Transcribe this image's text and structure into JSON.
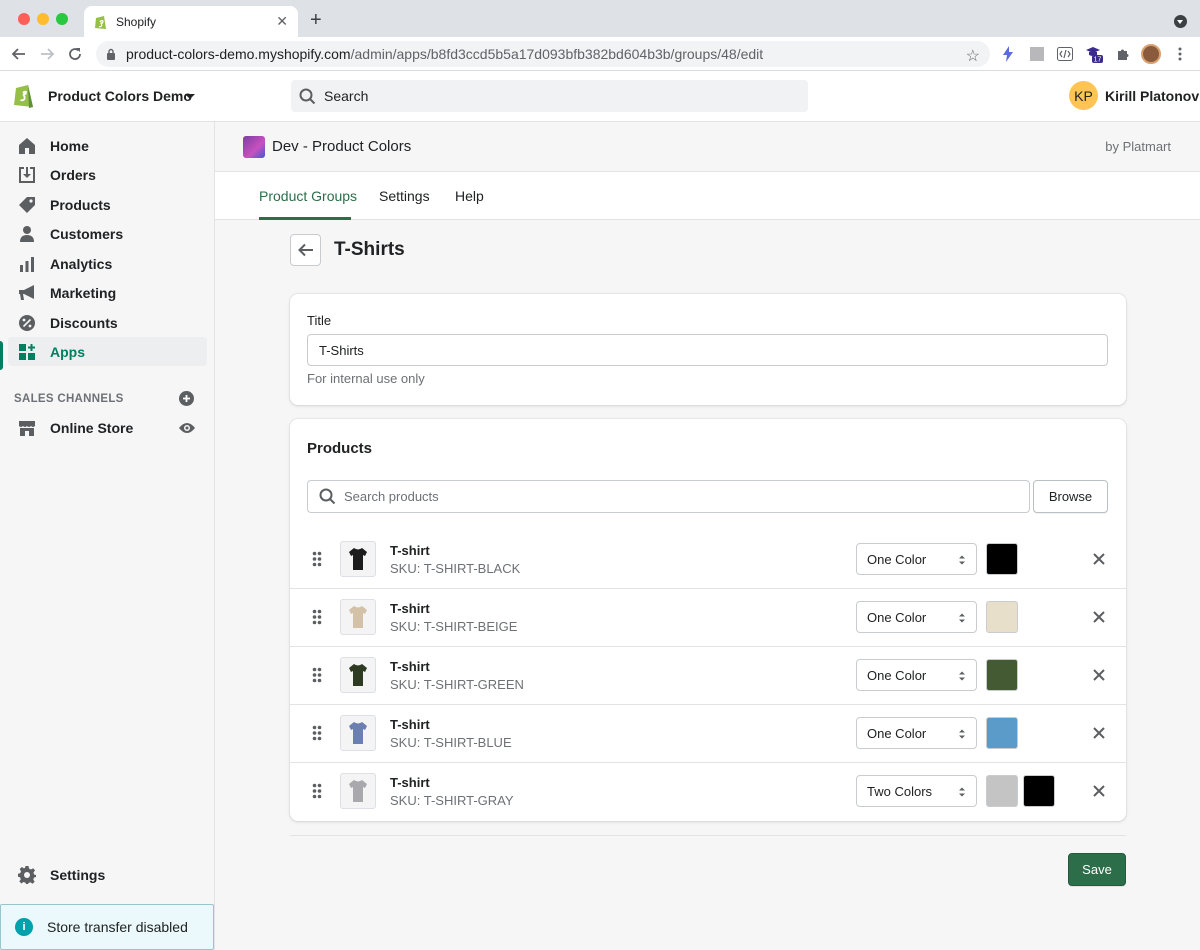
{
  "browser": {
    "tab_title": "Shopify",
    "url_host": "product-colors-demo.myshopify.com",
    "url_path": "/admin/apps/b8fd3ccd5b5a17d093bfb382bd604b3b/groups/48/edit",
    "ext_badge": "17"
  },
  "topbar": {
    "store_name": "Product Colors Demo",
    "search_placeholder": "Search",
    "avatar_initials": "KP",
    "user_name": "Kirill Platonov"
  },
  "sidebar": {
    "items": [
      {
        "label": "Home",
        "icon": "home-icon"
      },
      {
        "label": "Orders",
        "icon": "orders-icon"
      },
      {
        "label": "Products",
        "icon": "tag-icon"
      },
      {
        "label": "Customers",
        "icon": "person-icon"
      },
      {
        "label": "Analytics",
        "icon": "bar-chart-icon"
      },
      {
        "label": "Marketing",
        "icon": "megaphone-icon"
      },
      {
        "label": "Discounts",
        "icon": "discount-icon"
      },
      {
        "label": "Apps",
        "icon": "apps-icon",
        "active": true
      }
    ],
    "sales_channels_label": "SALES CHANNELS",
    "online_store_label": "Online Store",
    "settings_label": "Settings",
    "transfer_text": "Store transfer disabled",
    "accent_color": "#008060"
  },
  "app": {
    "title": "Dev - Product Colors",
    "by": "by Platmart",
    "tabs": [
      "Product Groups",
      "Settings",
      "Help"
    ],
    "selected_tab": "Product Groups"
  },
  "page": {
    "title": "T-Shirts",
    "title_label": "Title",
    "title_value": "T-Shirts",
    "title_help": "For internal use only",
    "products_heading": "Products",
    "search_products_placeholder": "Search products",
    "browse_label": "Browse",
    "save_label": "Save"
  },
  "products": [
    {
      "name": "T-shirt",
      "sku": "SKU: T-SHIRT-BLACK",
      "mode": "One Color",
      "shirt_color": "#1c1c1c",
      "colors": [
        "#000000"
      ]
    },
    {
      "name": "T-shirt",
      "sku": "SKU: T-SHIRT-BEIGE",
      "mode": "One Color",
      "shirt_color": "#d3c2a8",
      "colors": [
        "#e8dfcb"
      ]
    },
    {
      "name": "T-shirt",
      "sku": "SKU: T-SHIRT-GREEN",
      "mode": "One Color",
      "shirt_color": "#2f3a22",
      "colors": [
        "#445a33"
      ]
    },
    {
      "name": "T-shirt",
      "sku": "SKU: T-SHIRT-BLUE",
      "mode": "One Color",
      "shirt_color": "#6b7fb0",
      "colors": [
        "#5b9bc9"
      ]
    },
    {
      "name": "T-shirt",
      "sku": "SKU: T-SHIRT-GRAY",
      "mode": "Two Colors",
      "shirt_color": "#a9a9ad",
      "colors": [
        "#c4c4c4",
        "#000000"
      ]
    }
  ]
}
